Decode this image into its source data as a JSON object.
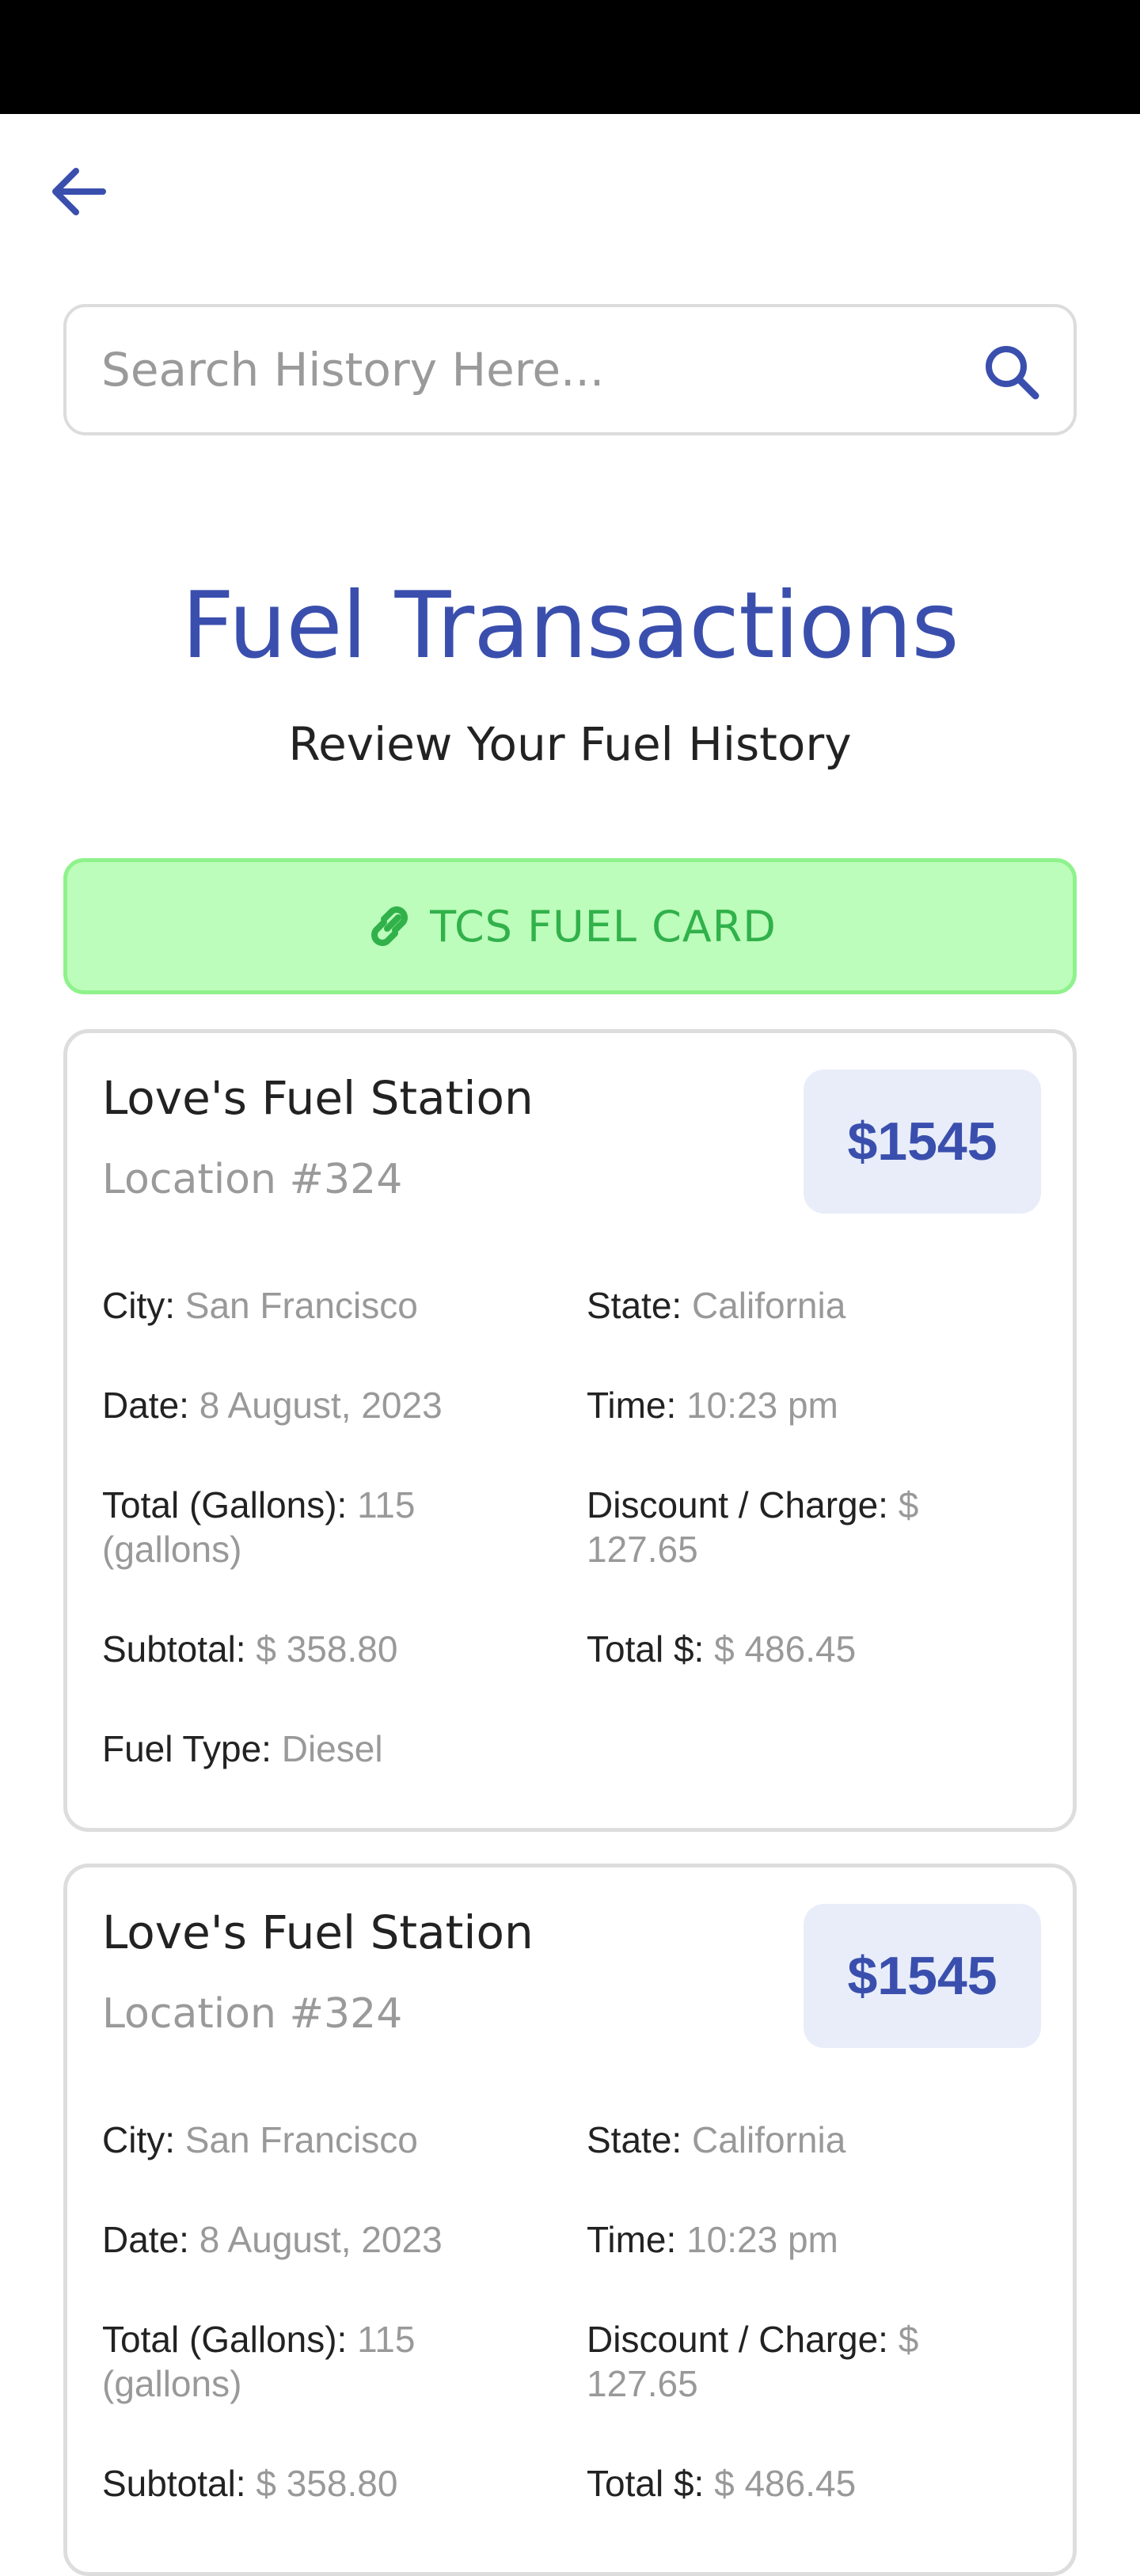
{
  "search": {
    "placeholder": "Search History Here..."
  },
  "header": {
    "title": "Fuel Transactions",
    "subtitle": "Review Your Fuel History"
  },
  "fuel_card_button": {
    "label": "TCS FUEL CARD",
    "color": "#31b14a",
    "background": "#bcfdbb"
  },
  "icons": {
    "back": "arrow-left-icon",
    "search": "search-icon",
    "link": "link-icon"
  },
  "colors": {
    "accent": "#3a4fad",
    "badge_background": "#e8edf9",
    "muted_text": "#999999"
  },
  "transactions": [
    {
      "station": "Love's Fuel Station",
      "location": "Location #324",
      "amount": "$1545",
      "city_label": "City:",
      "city": "San Francisco",
      "state_label": "State:",
      "state": "California",
      "date_label": "Date:",
      "date": "8 August, 2023",
      "time_label": "Time:",
      "time": "10:23 pm",
      "gallons_label": "Total (Gallons):",
      "gallons": "115 (gallons)",
      "discount_label": "Discount / Charge:",
      "discount": "$ 127.65",
      "subtotal_label": "Subtotal:",
      "subtotal": "$ 358.80",
      "total_label": "Total $:",
      "total": "$ 486.45",
      "fuel_type_label": "Fuel Type:",
      "fuel_type": "Diesel"
    },
    {
      "station": "Love's Fuel Station",
      "location": "Location #324",
      "amount": "$1545",
      "city_label": "City:",
      "city": "San Francisco",
      "state_label": "State:",
      "state": "California",
      "date_label": "Date:",
      "date": "8 August, 2023",
      "time_label": "Time:",
      "time": "10:23 pm",
      "gallons_label": "Total (Gallons):",
      "gallons": "115 (gallons)",
      "discount_label": "Discount / Charge:",
      "discount": "$ 127.65",
      "subtotal_label": "Subtotal:",
      "subtotal": "$ 358.80",
      "total_label": "Total $:",
      "total": "$ 486.45"
    }
  ]
}
